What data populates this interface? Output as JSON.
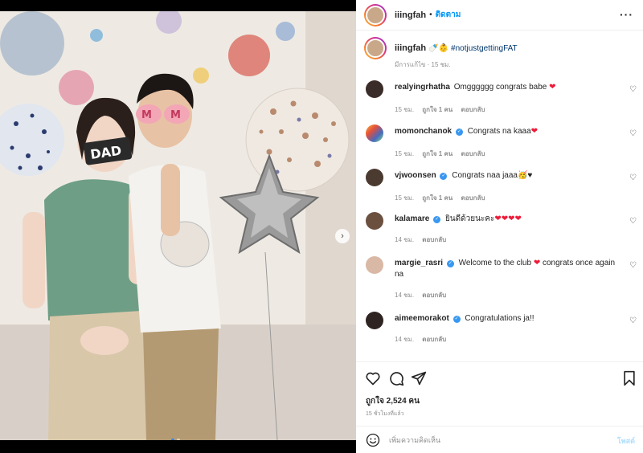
{
  "header": {
    "username": "iiingfah",
    "separator": "•",
    "follow_label": "ติดตาม",
    "more_icon": "more-horizontal-icon"
  },
  "caption": {
    "username": "iiingfah",
    "emojis": "🍼👶",
    "hashtag": "#notjustgettingFAT",
    "meta": "มีการแก้ไข · 15 ชม."
  },
  "comments": [
    {
      "username": "realyingrhatha",
      "verified": false,
      "text": "Omgggggg congrats babe ",
      "hearts": "❤",
      "time": "15 ชม.",
      "likes": "ถูกใจ 1 คน",
      "reply": "ตอบกลับ"
    },
    {
      "username": "momonchanok",
      "verified": true,
      "text": "Congrats na kaaa",
      "hearts": "❤",
      "time": "15 ชม.",
      "likes": "ถูกใจ 1 คน",
      "reply": "ตอบกลับ"
    },
    {
      "username": "vjwoonsen",
      "verified": true,
      "text": "Congrats naa jaaa🥳♥",
      "hearts": "",
      "time": "15 ชม.",
      "likes": "ถูกใจ 1 คน",
      "reply": "ตอบกลับ"
    },
    {
      "username": "kalamare",
      "verified": true,
      "text": "ยินดีด้วยนะคะ",
      "hearts": "❤❤❤❤",
      "time": "14 ชม.",
      "likes": "",
      "reply": "ตอบกลับ"
    },
    {
      "username": "margie_rasri",
      "verified": true,
      "text": "Welcome to the club ",
      "hearts": "❤",
      "text2": " congrats once again na",
      "time": "14 ชม.",
      "likes": "",
      "reply": "ตอบกลับ"
    },
    {
      "username": "aimeemorakot",
      "verified": true,
      "text": "Congratulations ja!!",
      "hearts": "",
      "time": "14 ชม.",
      "likes": "",
      "reply": "ตอบกลับ"
    }
  ],
  "actions": {
    "like_icon": "heart-icon",
    "comment_icon": "comment-icon",
    "share_icon": "share-icon",
    "save_icon": "bookmark-icon",
    "likes_text": "ถูกใจ 2,524 คน",
    "posted_ago": "15 ชั่วโมงที่แล้ว"
  },
  "add_comment": {
    "placeholder": "เพิ่มความคิดเห็น",
    "post_label": "โพสต์",
    "emoji_icon": "smiley-icon"
  },
  "carousel": {
    "next_icon": "chevron-right-icon",
    "page_count": 2,
    "active_index": 0
  },
  "colors": {
    "link_blue": "#0095f6",
    "hashtag": "#00376b",
    "verified": "#3897f0",
    "heart_red": "#ed1c3a"
  }
}
